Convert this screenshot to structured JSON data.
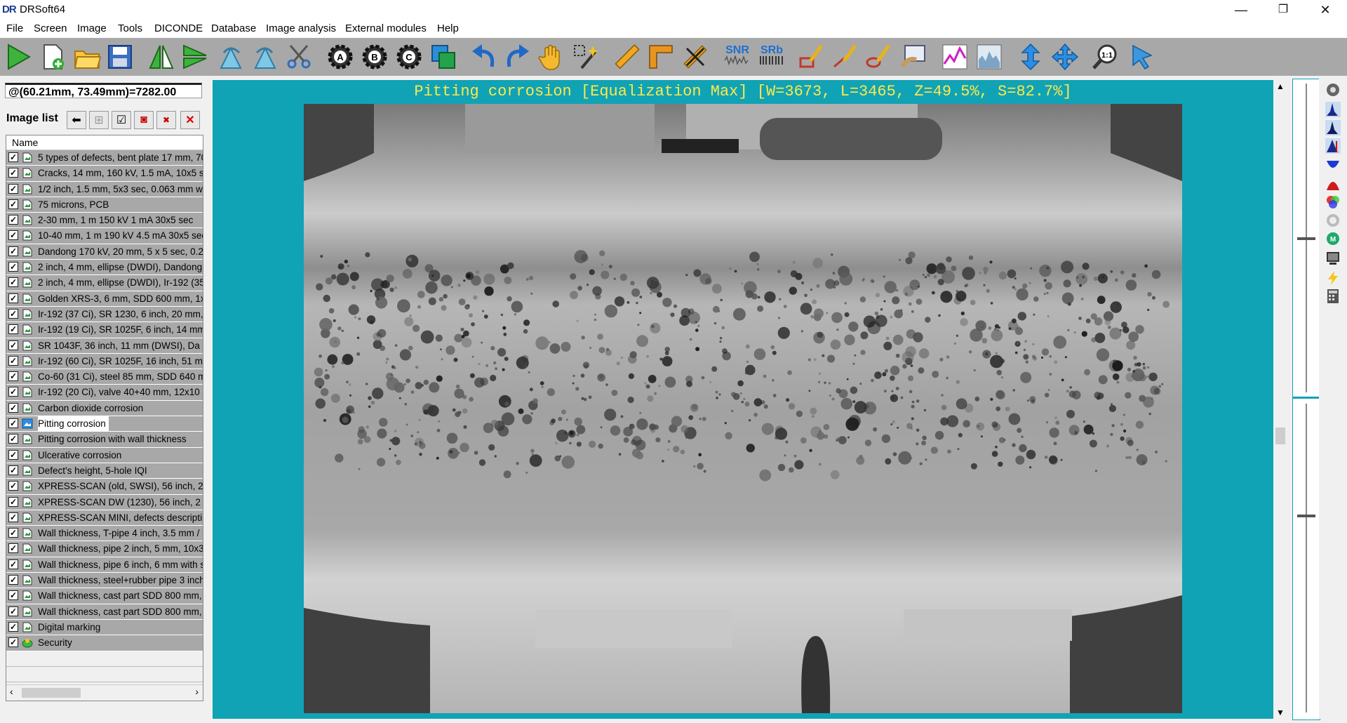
{
  "window": {
    "logo": "DR",
    "title": "DRSoft64",
    "min": "—",
    "max": "❐",
    "close": "✕"
  },
  "menu": [
    "File",
    "Screen",
    "Image",
    "Tools",
    "DICONDE",
    "Database",
    "Image analysis",
    "External modules",
    "Help"
  ],
  "toolbar": {
    "snr_label": "SNR",
    "srb_label": "SRb"
  },
  "left_panel": {
    "coordinate_readout": "@(60.21mm, 73.49mm)=7282.00",
    "image_list_label": "Image list",
    "column_header": "Name",
    "items": [
      {
        "label": "5 types of defects, bent plate 17 mm, 70",
        "checked": true
      },
      {
        "label": "Cracks, 14 mm, 160 kV, 1.5 mA, 10x5 s",
        "checked": true
      },
      {
        "label": "1/2 inch, 1.5 mm, 5x3 sec, 0.063 mm w",
        "checked": true
      },
      {
        "label": "75 microns, PCB",
        "checked": true
      },
      {
        "label": "2-30 mm, 1 m 150 kV 1 mA 30x5 sec",
        "checked": true
      },
      {
        "label": "10-40 mm, 1 m 190 kV 4.5 mA 30x5 sec",
        "checked": true
      },
      {
        "label": "Dandong 170 kV, 20 mm, 5 x 5 sec, 0.2",
        "checked": true
      },
      {
        "label": "2 inch, 4 mm, ellipse (DWDI), Dandong,",
        "checked": true
      },
      {
        "label": "2 inch, 4 mm, ellipse (DWDI), Ir-192 (35",
        "checked": true
      },
      {
        "label": "Golden XRS-3, 6 mm, SDD 600 mm, 1x",
        "checked": true
      },
      {
        "label": "Ir-192 (37 Ci), SR 1230, 6 inch, 20 mm,",
        "checked": true
      },
      {
        "label": "Ir-192 (19 Ci), SR 1025F, 6 inch, 14 mm",
        "checked": true
      },
      {
        "label": "SR 1043F, 36 inch, 11 mm (DWSI), Da",
        "checked": true
      },
      {
        "label": "Ir-192 (60 Ci), SR 1025F, 16 inch, 51 mi",
        "checked": true
      },
      {
        "label": "Co-60 (31 Ci), steel 85 mm, SDD 640 m",
        "checked": true
      },
      {
        "label": "Ir-192 (20 Ci), valve 40+40 mm, 12x10 s",
        "checked": true
      },
      {
        "label": "Carbon dioxide corrosion",
        "checked": true
      },
      {
        "label": "Pitting corrosion",
        "checked": true,
        "selected": true
      },
      {
        "label": "Pitting corrosion with wall thickness",
        "checked": true
      },
      {
        "label": "Ulcerative corrosion",
        "checked": true
      },
      {
        "label": "Defect's height, 5-hole IQI",
        "checked": true
      },
      {
        "label": "XPRESS-SCAN (old, SWSI), 56 inch, 2",
        "checked": true
      },
      {
        "label": "XPRESS-SCAN DW (1230), 56 inch, 2",
        "checked": true
      },
      {
        "label": "XPRESS-SCAN MINI, defects descripti",
        "checked": true
      },
      {
        "label": "Wall thickness, T-pipe 4 inch, 3.5 mm /",
        "checked": true
      },
      {
        "label": "Wall thickness, pipe 2 inch, 5 mm, 10x3",
        "checked": true
      },
      {
        "label": "Wall thickness, pipe 6 inch, 6 mm with s",
        "checked": true
      },
      {
        "label": "Wall thickness, steel+rubber pipe 3 inch",
        "checked": true
      },
      {
        "label": "Wall thickness, cast part SDD 800 mm,",
        "checked": true
      },
      {
        "label": "Wall thickness, cast part SDD 800 mm,",
        "checked": true
      },
      {
        "label": "Digital marking",
        "checked": true
      },
      {
        "label": "Security",
        "checked": true,
        "icon": "security-icon"
      }
    ]
  },
  "viewer": {
    "caption": "Pitting corrosion [Equalization Max] [W=3673, L=3465, Z=49.5%, S=82.7%]"
  },
  "colors": {
    "viewer_bg": "#10a3b5",
    "caption": "#ffe84a",
    "toolbar_bg": "#a8a8a8"
  }
}
